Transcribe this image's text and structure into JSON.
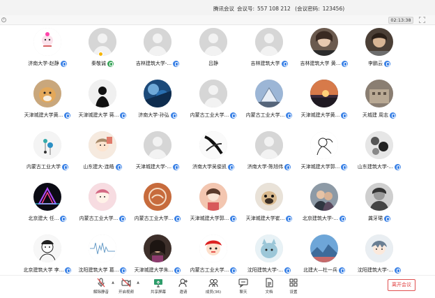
{
  "titlebar": {
    "meeting_app": "腾讯会议",
    "meeting_id_label": "会议号:",
    "meeting_id": "557 108 212",
    "password_label": "(会议密码:",
    "password": "123456)"
  },
  "topbar": {
    "timer": "02:13:38"
  },
  "participants": [
    {
      "name": "济南大学-赵静",
      "avatar": "sticker",
      "mic": "blue"
    },
    {
      "name": "秦敬诚",
      "avatar": "default",
      "mic": "green",
      "host": true
    },
    {
      "name": "吉林建筑大学-...",
      "avatar": "default",
      "mic": "blue"
    },
    {
      "name": "吕静",
      "avatar": "default",
      "mic": "none"
    },
    {
      "name": "吉林建筑大学",
      "avatar": "default",
      "mic": "blue"
    },
    {
      "name": "吉林建筑大学 黄...",
      "avatar": "photo-portrait",
      "mic": "blue"
    },
    {
      "name": "李鹏云",
      "avatar": "photo-portrait2",
      "mic": "blue"
    },
    {
      "name": "天津城建大学黄...",
      "avatar": "dog",
      "mic": "blue"
    },
    {
      "name": "天津城建大学 蒋...",
      "avatar": "silhouette",
      "mic": "blue"
    },
    {
      "name": "济南大学-孙弘",
      "avatar": "artwork-blue",
      "mic": "blue"
    },
    {
      "name": "内蒙古工业大学...",
      "avatar": "default",
      "mic": "blue"
    },
    {
      "name": "内蒙古工业大学...",
      "avatar": "pyramid",
      "mic": "blue"
    },
    {
      "name": "天津城建大学黄...",
      "avatar": "sunset",
      "mic": "blue"
    },
    {
      "name": "天城建  周志",
      "avatar": "building",
      "mic": "blue"
    },
    {
      "name": "内蒙古工业大学",
      "avatar": "earrings",
      "mic": "blue"
    },
    {
      "name": "山东建大-连皓",
      "avatar": "cartoon-girl",
      "mic": "blue"
    },
    {
      "name": "天津城建大学-...",
      "avatar": "default",
      "mic": "blue"
    },
    {
      "name": "济南大学吴俊凯",
      "avatar": "ink-bw",
      "mic": "blue"
    },
    {
      "name": "济南大学-陈旭伟",
      "avatar": "default",
      "mic": "blue"
    },
    {
      "name": "天津城建大学郭...",
      "avatar": "line-sketch",
      "mic": "blue"
    },
    {
      "name": "山东建筑大学-...",
      "avatar": "flowers-bw",
      "mic": "blue"
    },
    {
      "name": "北京建大 任...",
      "avatar": "neon-triangle",
      "mic": "blue"
    },
    {
      "name": "内蒙古工业大学...",
      "avatar": "cartoon-pink",
      "mic": "blue"
    },
    {
      "name": "内蒙古工业大学...",
      "avatar": "logo-circle",
      "mic": "blue"
    },
    {
      "name": "天津城建大学郭...",
      "avatar": "illustration",
      "mic": "blue"
    },
    {
      "name": "天津城建大学崔...",
      "avatar": "pug",
      "mic": "blue"
    },
    {
      "name": "北京建筑大学-...",
      "avatar": "couple",
      "mic": "blue"
    },
    {
      "name": "龚牙珺",
      "avatar": "bw-portrait",
      "mic": "blue"
    },
    {
      "name": "北京建筑大学 李...",
      "avatar": "comic",
      "mic": "blue"
    },
    {
      "name": "沈阳建筑大学 葛...",
      "avatar": "waveform",
      "mic": "blue"
    },
    {
      "name": "天津城建大学朱...",
      "avatar": "woman-photo",
      "mic": "blue"
    },
    {
      "name": "内蒙古工业大学...",
      "avatar": "red-character",
      "mic": "blue"
    },
    {
      "name": "沈阳建筑大学-...",
      "avatar": "cartoon-creature",
      "mic": "blue"
    },
    {
      "name": "北建大—杜一兵",
      "avatar": "landscape",
      "mic": "blue"
    },
    {
      "name": "沈阳建筑大学-...",
      "avatar": "anime-boy",
      "mic": "blue"
    }
  ],
  "toolbar": {
    "items": [
      {
        "label": "解除静音",
        "icon": "muted-mic-icon",
        "caret": true
      },
      {
        "label": "开启视频",
        "icon": "camera-off-icon",
        "caret": true
      },
      {
        "label": "共享屏幕",
        "icon": "screen-share-icon"
      },
      {
        "label": "邀请",
        "icon": "invite-icon"
      },
      {
        "label": "成员(36)",
        "icon": "members-icon"
      },
      {
        "label": "聊天",
        "icon": "chat-icon"
      },
      {
        "label": "文档",
        "icon": "document-icon"
      },
      {
        "label": "设置",
        "icon": "settings-icon"
      }
    ],
    "end_label": "离开会议"
  },
  "colors": {
    "mic_blue": "#3b82e6",
    "mic_green": "#3aa55a",
    "end_red": "#e04040"
  }
}
